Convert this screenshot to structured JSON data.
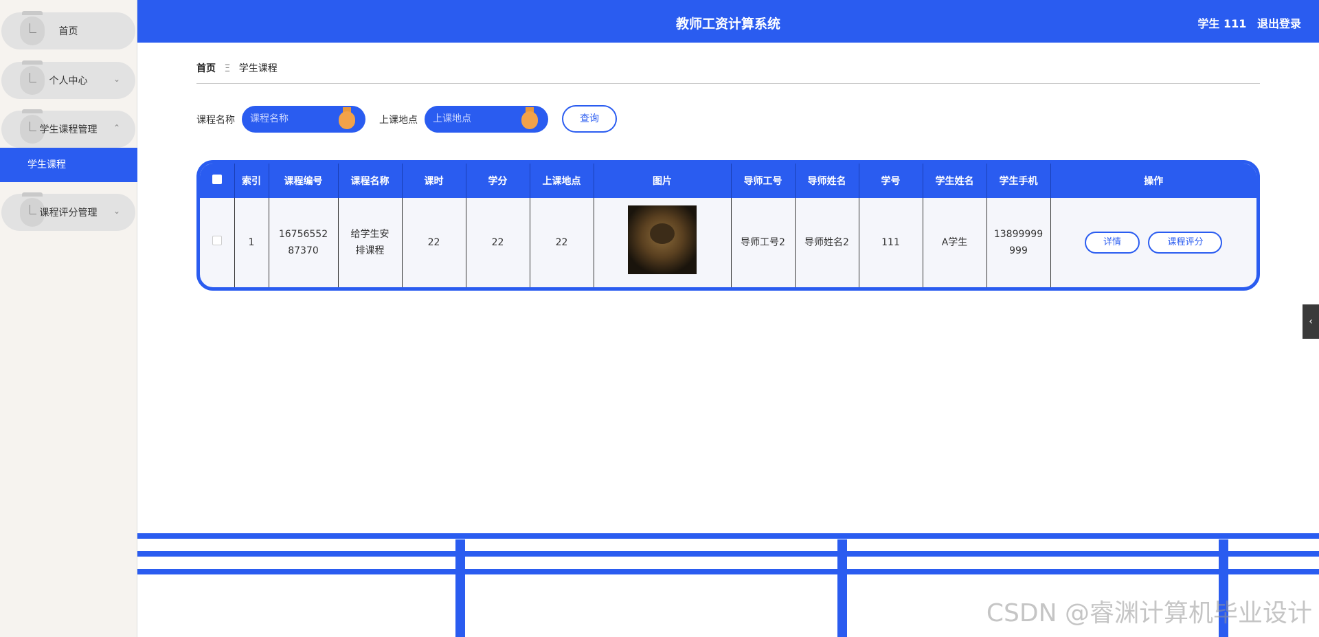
{
  "sidebar": {
    "items": [
      {
        "label": "首页",
        "arrow": ""
      },
      {
        "label": "个人中心",
        "arrow": "⌄"
      },
      {
        "label": "学生课程管理",
        "arrow": "⌃"
      },
      {
        "label": "课程评分管理",
        "arrow": "⌄"
      }
    ],
    "active_sub": "学生课程"
  },
  "header": {
    "title": "教师工资计算系统",
    "user": "学生 111",
    "logout": "退出登录"
  },
  "breadcrumb": {
    "home": "首页",
    "sep": "Ξ",
    "current": "学生课程"
  },
  "search": {
    "course_label": "课程名称",
    "course_placeholder": "课程名称",
    "place_label": "上课地点",
    "place_placeholder": "上课地点",
    "button": "查询"
  },
  "table": {
    "headers": [
      "索引",
      "课程编号",
      "课程名称",
      "课时",
      "学分",
      "上课地点",
      "图片",
      "导师工号",
      "导师姓名",
      "学号",
      "学生姓名",
      "学生手机",
      "操作"
    ],
    "rows": [
      {
        "index": "1",
        "course_no": "1675655287370",
        "course_name": "给学生安排课程",
        "hours": "22",
        "credit": "22",
        "place": "22",
        "teacher_id": "导师工号2",
        "teacher_name": "导师姓名2",
        "student_no": "111",
        "student_name": "A学生",
        "phone": "13899999999",
        "btn_detail": "详情",
        "btn_rate": "课程评分"
      }
    ]
  },
  "side_tab": "‹",
  "watermark": "CSDN @睿渊计算机毕业设计",
  "colors": {
    "primary": "#2a5cf0",
    "sidebar_bg": "#f6f3ef",
    "medal": "#f2a24a"
  }
}
